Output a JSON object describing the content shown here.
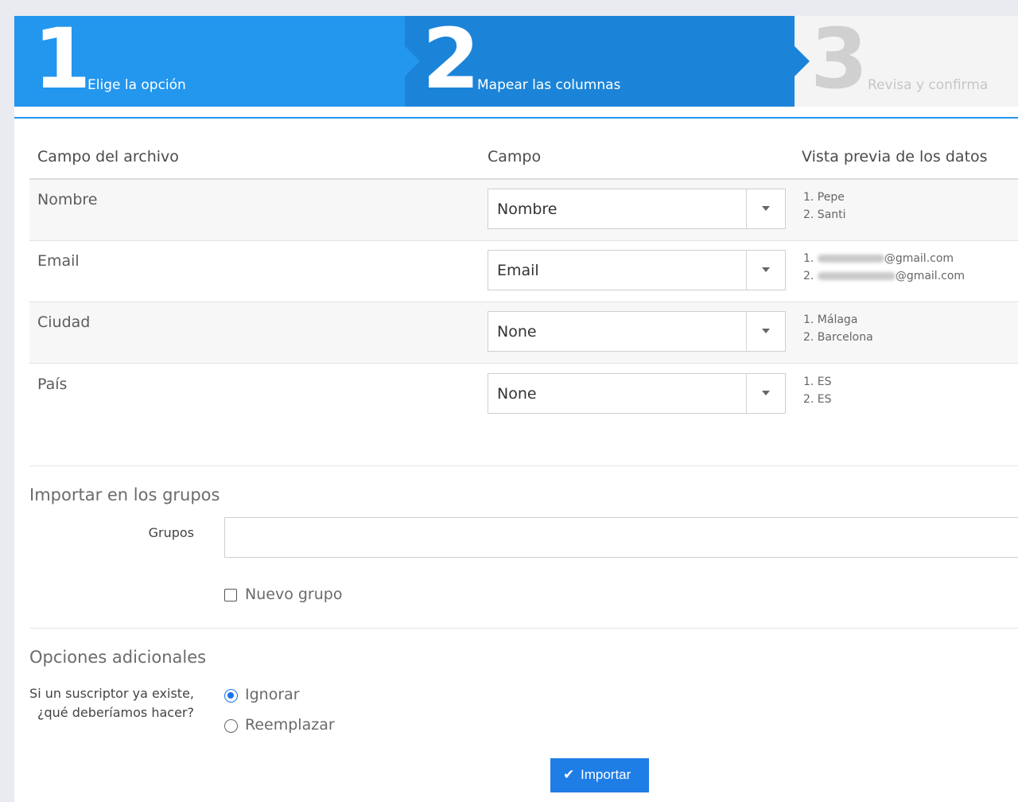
{
  "wizard": {
    "steps": [
      {
        "number": "1",
        "label": "Elige la opción"
      },
      {
        "number": "2",
        "label": "Mapear las columnas"
      },
      {
        "number": "3",
        "label": "Revisa y confirma"
      }
    ]
  },
  "mapping": {
    "headers": {
      "file_field": "Campo del archivo",
      "field": "Campo",
      "preview": "Vista previa de los datos"
    },
    "rows": [
      {
        "file_field": "Nombre",
        "selected": "Nombre",
        "preview": [
          "1. Pepe",
          "2. Santi"
        ]
      },
      {
        "file_field": "Email",
        "selected": "Email",
        "preview_prefix": [
          "1.",
          "2."
        ],
        "preview_suffix": [
          "@gmail.com",
          "@gmail.com"
        ]
      },
      {
        "file_field": "Ciudad",
        "selected": "None",
        "preview": [
          "1. Málaga",
          "2. Barcelona"
        ]
      },
      {
        "file_field": "País",
        "selected": "None",
        "preview": [
          "1. ES",
          "2. ES"
        ]
      }
    ]
  },
  "groups": {
    "title": "Importar en los grupos",
    "label": "Grupos",
    "input_value": "",
    "new_group_label": "Nuevo grupo",
    "new_group_checked": false
  },
  "options": {
    "title": "Opciones adicionales",
    "question_line1": "Si un suscriptor ya existe,",
    "question_line2": "¿qué deberíamos hacer?",
    "choices": [
      "Ignorar",
      "Reemplazar"
    ],
    "selected": "Ignorar"
  },
  "import_button": {
    "label": "Importar",
    "icon": "check-icon"
  },
  "colors": {
    "accent": "#2396ee",
    "accent_dark": "#1c84d8",
    "button": "#1f7de6"
  }
}
